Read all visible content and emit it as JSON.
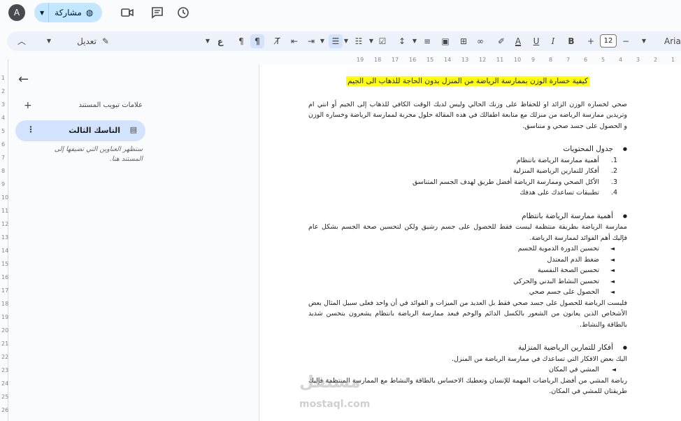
{
  "header": {
    "avatar_letter": "A",
    "share_label": "مشاركة"
  },
  "toolbar": {
    "font_name": "Arial",
    "font_size": "12",
    "mode_label": "تعديل"
  },
  "ruler": {
    "horizontal_ticks": [
      "1",
      "2",
      "3",
      "4",
      "5",
      "6",
      "7",
      "8",
      "9",
      "10",
      "11",
      "12",
      "13",
      "14",
      "15",
      "16",
      "17",
      "18",
      "19"
    ],
    "vertical_ticks": [
      "1",
      "2",
      "3",
      "4",
      "5",
      "6",
      "7",
      "8",
      "9",
      "10",
      "11",
      "12",
      "13",
      "14",
      "15",
      "16",
      "17",
      "18",
      "19",
      "20",
      "21",
      "22",
      "23",
      "24",
      "25",
      "26"
    ]
  },
  "sidebar": {
    "tabs_title": "علامات تبويب المستند",
    "active_tab": "التاسك الثالث",
    "hint": "ستظهر العناوين التي تضيفها إلى المستند هنا."
  },
  "document": {
    "title": "كيفية خسارة الوزن بممارسة الرياضة من المنزل بدون الحاجة للذهاب الى الجيم",
    "intro": "صحي لخساره الوزن الزائد او للحفاظ على وزنك الحالي وليس لديك الوقت الكافي للذهاب إلى الجيم أو انتي ام وتريدين ممارسة الرياضه من منزلك مع متابعة اطفالك في هذه المقالة حلول مجربة لممارسة الرياضة وخساره الوزن و الحصول على جسد صحي و متناسق.",
    "toc_heading": "جدول المحتويات",
    "toc": [
      {
        "n": "1.",
        "text": "أهمية ممارسة الرياضة بانتظام"
      },
      {
        "n": "2.",
        "text": "أفكار للتمارين الرياضية المنزلية"
      },
      {
        "n": "3.",
        "text": "الأكل الصحي وممارسة الرياضة أفضل طريق لهدف الجسم المتناسق"
      },
      {
        "n": "4.",
        "text": "تطبيقات تساعدك على هدفك"
      }
    ],
    "section1_heading": "أهمية ممارسة الرياضة بانتظام",
    "section1_para": "ممارسة الرياضة بطريقة منتظمة ليست فقط للحصول على جسم رشيق ولكن لتحسين صحة الجسم بشكل عام فإليك أهم الفوائد لممارسة الرياضة.",
    "benefits": [
      "تحسين الدورة الدموية للجسم",
      "ضغط الدم المعتدل",
      "تحسين الصحة النفسية",
      "تحسين النشاط البدني والحركي",
      "الحصول على جسم صحي"
    ],
    "section1_para2": "فليست الرياضة للحصول على جسد صحي فقط بل العديد من الميزات و الفوائد في أن واحد فعلى سبيل المثال بعض الأشخاص الذين يعانون من الشعور بالكسل الدائم والوخم فبعد ممارسة الرياضة بانتظام يشعرون بتحسن شديد بالطاقة والنشاط.",
    "section2_heading": "أفكار للتمارين الرياضية المنزلية",
    "section2_intro": "اليك بعض الافكار التي تساعدك في ممارسة الرياضة من المنزل.",
    "exercise1": "المشي في المكان",
    "exercise1_para": "رياضة المشي من أفضل الرياضات المهمة للإنسان وتعطيك الاحساس بالطاقة والنشاط مع الممارسة المنتظمة فإليك طريقتان للمشي في المكان."
  },
  "watermark": {
    "arabic": "مستقل",
    "latin": "mostaql.com"
  }
}
